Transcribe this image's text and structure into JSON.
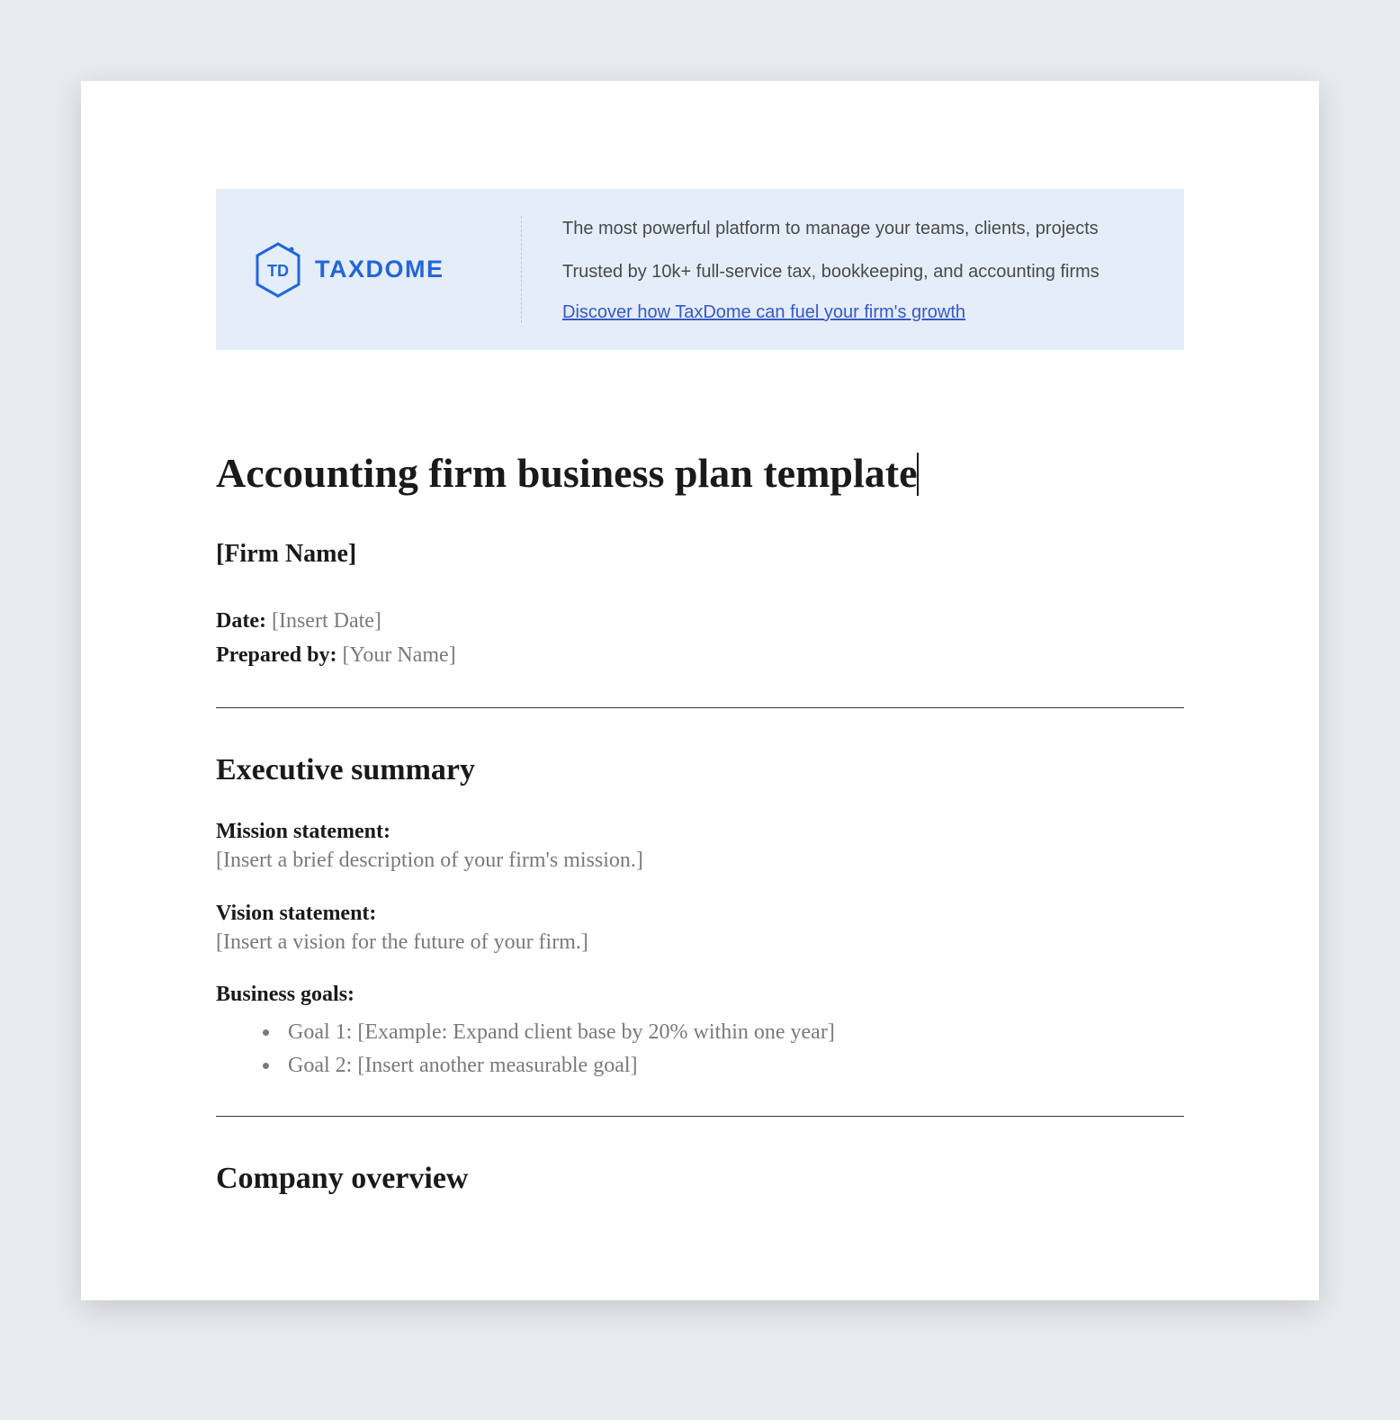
{
  "banner": {
    "logo_td": "TD",
    "logo_name": "TAXDOME",
    "line1": "The most powerful platform to manage your teams, clients, projects",
    "line2": "Trusted by 10k+ full-service tax, bookkeeping, and accounting firms",
    "link_text": "Discover how TaxDome can fuel your firm's growth"
  },
  "title": "Accounting firm business plan template",
  "firm_name": "[Firm Name]",
  "meta": {
    "date_label": "Date:",
    "date_value": "[Insert Date]",
    "prepared_label": "Prepared by:",
    "prepared_value": "[Your Name]"
  },
  "sections": {
    "exec_summary": {
      "heading": "Executive summary",
      "mission_label": "Mission statement:",
      "mission_value": "[Insert a brief description of your firm's mission.]",
      "vision_label": "Vision statement:",
      "vision_value": "[Insert a vision for the future of your firm.]",
      "goals_label": "Business goals:",
      "goals": [
        "Goal 1: [Example: Expand client base by 20% within one year]",
        "Goal 2: [Insert another measurable goal]"
      ]
    },
    "company_overview": {
      "heading": "Company overview"
    }
  }
}
